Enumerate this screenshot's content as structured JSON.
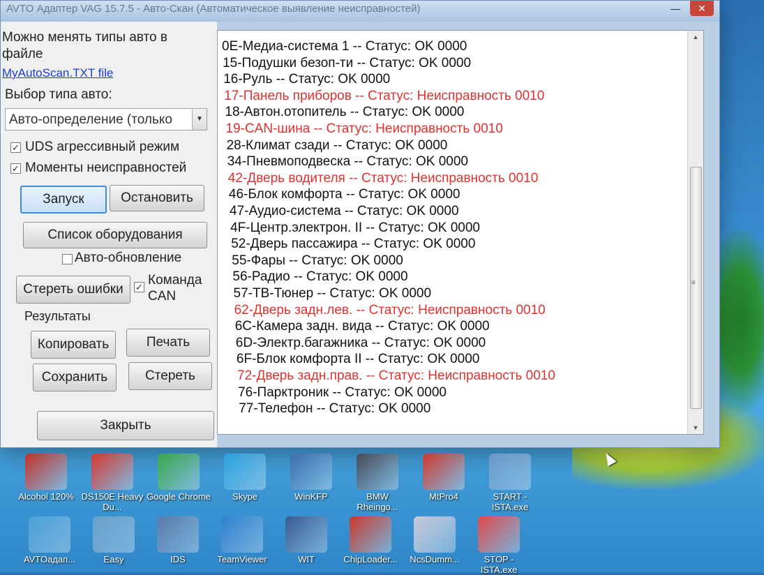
{
  "window": {
    "title": "AVTO Адаптер VAG 15.7.5 - Авто-Скан (Автоматическое выявление неисправностей)",
    "minimize_glyph": "—",
    "close_glyph": "✕"
  },
  "left": {
    "info_line1": "Можно менять типы авто в",
    "info_line2": "файле",
    "file_link": "MyAutoScan.TXT file",
    "car_type_label": "Выбор типа авто:",
    "car_type_value": "Авто-определение (только",
    "uds_label": "UDS агрессивный режим",
    "uds_checked": true,
    "moments_label": "Моменты неисправностей",
    "moments_checked": true,
    "start_button": "Запуск",
    "stop_button": "Остановить",
    "equipment_button": "Список оборудования",
    "autoupdate_label": "Авто-обновление",
    "autoupdate_checked": false,
    "clear_errors_button": "Стереть ошибки",
    "can_cmd_line1": "Команда",
    "can_cmd_line2": "CAN",
    "can_cmd_checked": true,
    "results_label": "Результаты",
    "copy_button": "Копировать",
    "print_button": "Печать",
    "save_button": "Сохранить",
    "erase_button": "Стереть",
    "close_button": "Закрыть"
  },
  "results": [
    {
      "text": "0E-Медиа-система 1 -- Статус: OK 0000",
      "fault": false
    },
    {
      "text": "15-Подушки безоп-ти -- Статус: OK 0000",
      "fault": false
    },
    {
      "text": "16-Руль -- Статус: OK 0000",
      "fault": false
    },
    {
      "text": "17-Панель приборов -- Статус: Неисправность 0010",
      "fault": true
    },
    {
      "text": "18-Автон.отопитель -- Статус: OK 0000",
      "fault": false
    },
    {
      "text": "19-CAN-шина -- Статус: Неисправность 0010",
      "fault": true
    },
    {
      "text": "28-Климат сзади -- Статус: OK 0000",
      "fault": false
    },
    {
      "text": "34-Пневмоподвеска -- Статус: OK 0000",
      "fault": false
    },
    {
      "text": "42-Дверь водителя -- Статус: Неисправность 0010",
      "fault": true
    },
    {
      "text": "46-Блок комфорта -- Статус: OK 0000",
      "fault": false
    },
    {
      "text": "47-Аудио-система -- Статус: OK 0000",
      "fault": false
    },
    {
      "text": "4F-Центр.электрон. II -- Статус: OK 0000",
      "fault": false
    },
    {
      "text": "52-Дверь пассажира -- Статус: OK 0000",
      "fault": false
    },
    {
      "text": "55-Фары -- Статус: OK 0000",
      "fault": false
    },
    {
      "text": "56-Радио -- Статус: OK 0000",
      "fault": false
    },
    {
      "text": "57-ТВ-Тюнер -- Статус: OK 0000",
      "fault": false
    },
    {
      "text": "62-Дверь задн.лев. -- Статус: Неисправность 0010",
      "fault": true
    },
    {
      "text": "6C-Камера задн. вида -- Статус: OK 0000",
      "fault": false
    },
    {
      "text": "6D-Электр.багажника -- Статус: OK 0000",
      "fault": false
    },
    {
      "text": "6F-Блок комфорта II -- Статус: OK 0000",
      "fault": false
    },
    {
      "text": "72-Дверь задн.прав. -- Статус: Неисправность 0010",
      "fault": true
    },
    {
      "text": "76-Парктроник -- Статус: OK 0000",
      "fault": false
    },
    {
      "text": "77-Телефон -- Статус: OK 0000",
      "fault": false
    }
  ],
  "colors": {
    "ok_text": "#111111",
    "fault_text": "#e0322e",
    "link": "#1a3ccc"
  },
  "desktop": {
    "row1": [
      {
        "label": "Alcohol 120%",
        "icon": "alcohol-icon",
        "color": "#c4322a"
      },
      {
        "label": "DS150E Heavy Du...",
        "icon": "ds150e-icon",
        "color": "#d8382f"
      },
      {
        "label": "Google Chrome",
        "icon": "chrome-icon",
        "color": "#3aa84a"
      },
      {
        "label": "Skype",
        "icon": "skype-icon",
        "color": "#2aa4e0"
      },
      {
        "label": "WinKFP",
        "icon": "winkfp-icon",
        "color": "#3b6fb0"
      },
      {
        "label": "BMW Rheingo...",
        "icon": "bmw-rheingold-icon",
        "color": "#4a4a58"
      },
      {
        "label": "MtPro4",
        "icon": "car-icon",
        "color": "#d03a30"
      },
      {
        "label": "START - ISTA.exe",
        "icon": "ista-start-icon",
        "color": "#6a9ac8"
      }
    ],
    "row2": [
      {
        "label": "AVTOадап...",
        "icon": "vcds-icon",
        "color": "#4aa0d8"
      },
      {
        "label": "Easy",
        "icon": "easy-icon",
        "color": "#6aa0c8"
      },
      {
        "label": "IDS",
        "icon": "ids-icon",
        "color": "#5a7aa8"
      },
      {
        "label": "TeamViewer",
        "icon": "teamviewer-icon",
        "color": "#2f7fd0"
      },
      {
        "label": "WIT",
        "icon": "wit-icon",
        "color": "#3a5a90"
      },
      {
        "label": "ChipLoader...",
        "icon": "chiploader-icon",
        "color": "#c83a2a"
      },
      {
        "label": "NcsDumm...",
        "icon": "ncsdummy-icon",
        "color": "#c8c8d8"
      },
      {
        "label": "STOP - ISTA.exe",
        "icon": "ista-stop-icon",
        "color": "#e04a4a"
      }
    ]
  }
}
